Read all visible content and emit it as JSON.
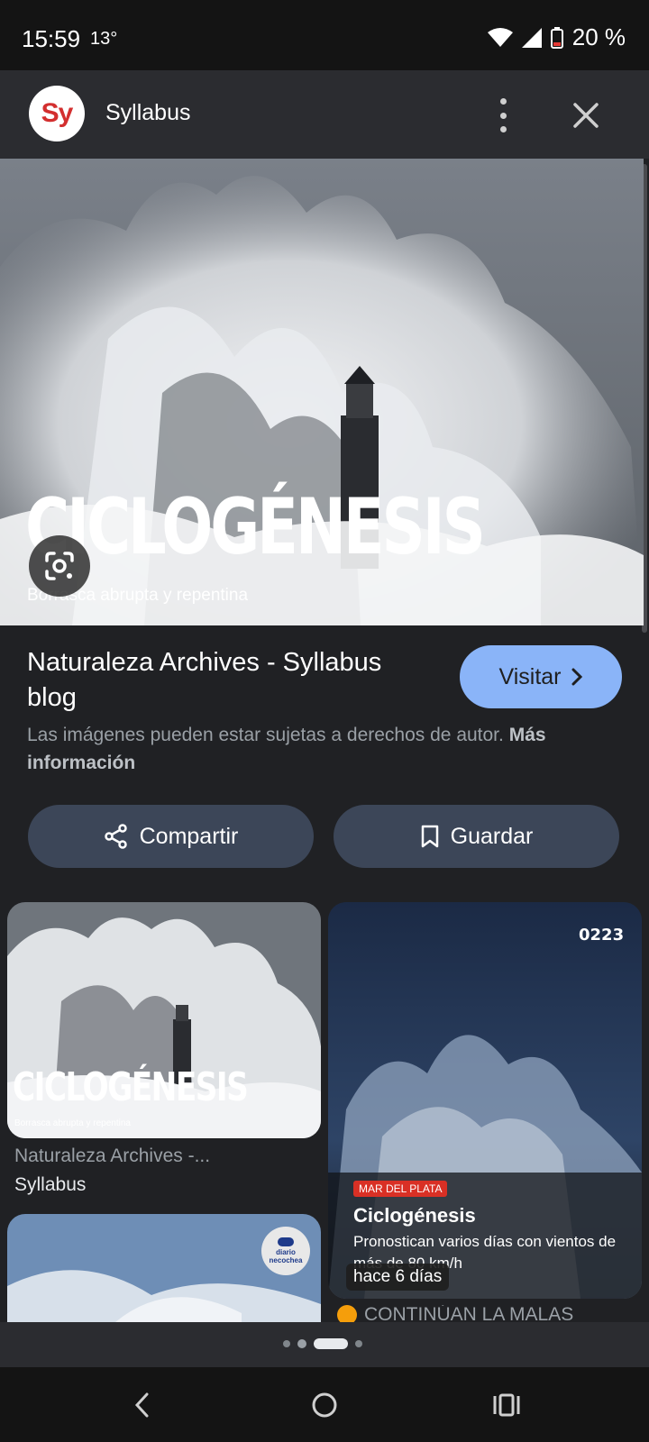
{
  "status_bar": {
    "time": "15:59",
    "temperature": "13°",
    "battery": "20 %"
  },
  "header": {
    "logo_text": "Sy",
    "title": "Syllabus",
    "icons": [
      "more-vert-icon",
      "close-icon"
    ]
  },
  "hero": {
    "title": "CICLOGÉNESIS",
    "subtitle": "Borrasca abrupta y repentina",
    "lens_icon": "google-lens-icon"
  },
  "info": {
    "source_title": "Naturaleza Archives - Syllabus blog",
    "visit_label": "Visitar",
    "copyright_text": "Las imágenes pueden estar sujetas a derechos de autor.",
    "more_info_link": "Más información"
  },
  "actions": {
    "share_label": "Compartir",
    "save_label": "Guardar"
  },
  "related": [
    {
      "title_overlay": "CICLOGÉNESIS",
      "subtitle_overlay": "Borrasca abrupta y repentina",
      "caption_line1": "Naturaleza Archives -...",
      "caption_line2": "Syllabus"
    },
    {
      "watermark": "0223",
      "tag": "MAR DEL PLATA",
      "headline": "Ciclogénesis",
      "description": "Pronostican varios días con vientos de más de 80 km/h",
      "time_badge": "hace 6 días",
      "caption": "CONTINÚAN LA MALAS"
    },
    {
      "badge_text": "diario necochea"
    }
  ],
  "pagination": {
    "count": 4,
    "active_index": 2
  },
  "colors": {
    "accent": "#8ab4f8",
    "background": "#202124",
    "button_bg": "#3c4658",
    "logo_red": "#d32f2f",
    "tag_red": "#d93025"
  }
}
